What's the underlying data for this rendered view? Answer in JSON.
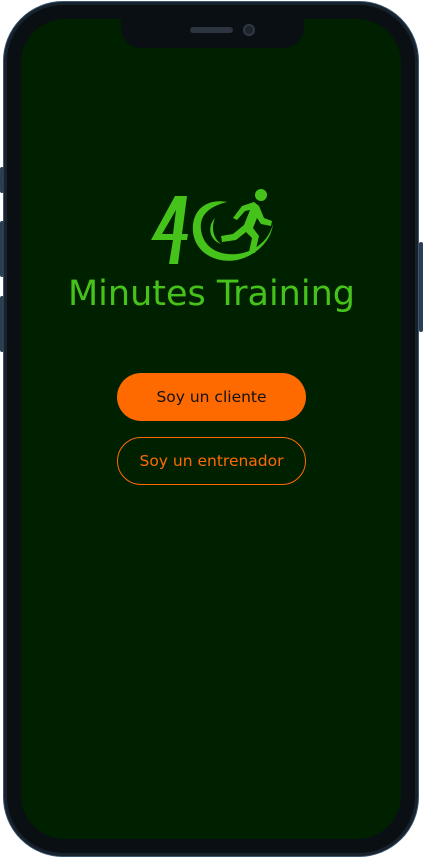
{
  "app": {
    "logo_text": "40",
    "name": "Minutes Training"
  },
  "actions": {
    "client_label": "Soy un cliente",
    "trainer_label": "Soy un entrenador"
  },
  "colors": {
    "background": "#002100",
    "brand_green": "#46c31a",
    "accent_orange": "#ff6a00"
  },
  "icons": {
    "logo": "runner-logo-icon"
  }
}
